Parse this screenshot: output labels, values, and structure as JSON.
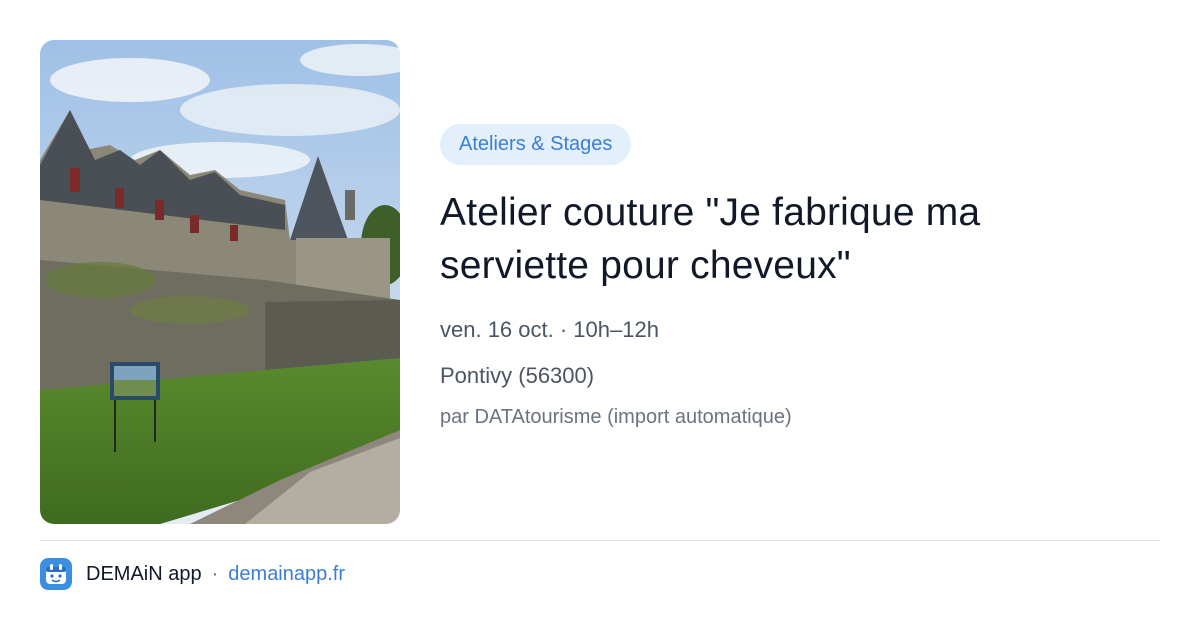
{
  "event": {
    "category": "Ateliers & Stages",
    "title": "Atelier couture \"Je fabrique ma serviette pour cheveux\"",
    "datetime": "ven. 16 oct. · 10h–12h",
    "location": "Pontivy (56300)",
    "source": "par DATAtourisme (import automatique)",
    "image_icon": "castle-photo"
  },
  "footer": {
    "app_name": "DEMAiN app",
    "separator": "·",
    "site": "demainapp.fr",
    "logo_icon": "demain-logo-icon"
  },
  "colors": {
    "accent": "#3b7fd4",
    "badge_bg": "#e3effb",
    "title": "#111827",
    "muted": "#4b5563"
  }
}
